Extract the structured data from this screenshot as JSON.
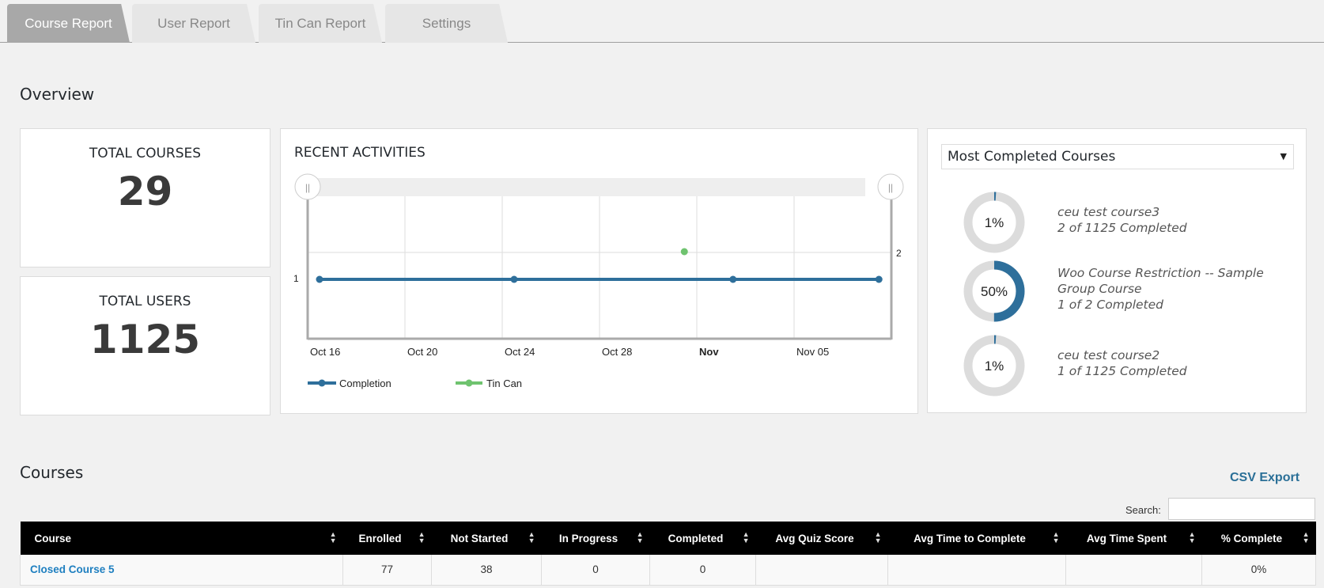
{
  "tabs": [
    {
      "label": "Course Report",
      "active": true
    },
    {
      "label": "User Report",
      "active": false
    },
    {
      "label": "Tin Can Report",
      "active": false
    },
    {
      "label": "Settings",
      "active": false
    }
  ],
  "overview": {
    "title": "Overview",
    "total_courses": {
      "label": "TOTAL COURSES",
      "value": "29"
    },
    "total_users": {
      "label": "TOTAL USERS",
      "value": "1125"
    }
  },
  "recent_activities": {
    "title": "RECENT ACTIVITIES",
    "legend": {
      "completion": "Completion",
      "tincan": "Tin Can"
    }
  },
  "chart_data": {
    "type": "line",
    "title": "RECENT ACTIVITIES",
    "x_ticks": [
      "Oct 16",
      "Oct 20",
      "Oct 24",
      "Oct 28",
      "Nov",
      "Nov 05"
    ],
    "y_left_ticks": [
      "1"
    ],
    "y_right_ticks": [
      "2"
    ],
    "xlim": [
      "Oct 16",
      "Nov 09"
    ],
    "ylim": [
      0,
      2.3
    ],
    "grid": true,
    "legend_position": "bottom-left",
    "series": [
      {
        "name": "Completion",
        "color": "#2e6f9b",
        "axis": "left",
        "x": [
          "Oct 16",
          "Oct 24",
          "Nov 02",
          "Nov 08"
        ],
        "y": [
          1,
          1,
          1,
          1
        ]
      },
      {
        "name": "Tin Can",
        "color": "#6fc36f",
        "axis": "right",
        "x": [
          "Oct 31"
        ],
        "y": [
          2
        ]
      }
    ]
  },
  "completed_courses": {
    "select_value": "Most Completed Courses",
    "items": [
      {
        "percent": 1,
        "percent_label": "1%",
        "name": "ceu test course3",
        "detail": "2 of 1125 Completed"
      },
      {
        "percent": 50,
        "percent_label": "50%",
        "name": "Woo Course Restriction -- Sample Group Course",
        "detail": "1 of 2 Completed"
      },
      {
        "percent": 1,
        "percent_label": "1%",
        "name": "ceu test course2",
        "detail": "1 of 1125 Completed"
      }
    ]
  },
  "courses": {
    "title": "Courses",
    "csv_export": "CSV Export",
    "search_label": "Search:",
    "search_value": "",
    "columns": [
      "Course",
      "Enrolled",
      "Not Started",
      "In Progress",
      "Completed",
      "Avg Quiz Score",
      "Avg Time to Complete",
      "Avg Time Spent",
      "% Complete"
    ],
    "rows": [
      {
        "course": "Closed Course 5",
        "enrolled": "77",
        "not_started": "38",
        "in_progress": "0",
        "completed": "0",
        "avg_quiz": "",
        "avg_time_complete": "",
        "avg_time_spent": "",
        "pct": "0%"
      }
    ]
  },
  "colors": {
    "accent": "#2e6f9b",
    "tincan": "#6fc36f",
    "link": "#1e7fc0"
  }
}
